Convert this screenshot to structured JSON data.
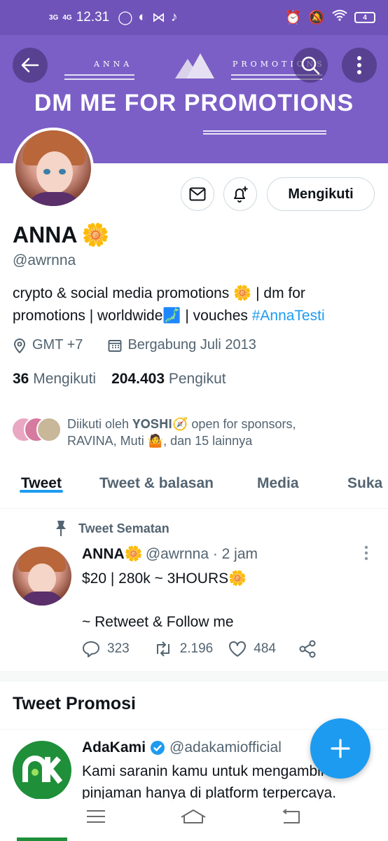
{
  "status_bar": {
    "network_1": "3G",
    "network_2": "4G",
    "time": "12.31",
    "battery": "4"
  },
  "banner": {
    "left_label": "ANNA",
    "right_label": "PROMOTIONS",
    "headline": "DM ME FOR PROMOTIONS",
    "color": "#7b5fc7"
  },
  "profile": {
    "follow_button": "Mengikuti",
    "name": "ANNA",
    "name_emoji": "🌼",
    "handle": "@awrnna",
    "bio_part1": "crypto & social media promotions 🌼  | dm for promotions | worldwide🗾 | vouches ",
    "bio_hashtag": "#AnnaTesti",
    "location": "GMT +7",
    "joined": "Bergabung Juli 2013",
    "following_count": "36",
    "following_label": "Mengikuti",
    "followers_count": "204.403",
    "followers_label": "Pengikut",
    "followed_by": "Diikuti oleh 𝐘𝐎𝐒𝐇𝐈🧭 open for sponsors, RAVINA, Muti 🤷, dan 15 lainnya"
  },
  "tabs": [
    {
      "label": "Tweet"
    },
    {
      "label": "Tweet & balasan"
    },
    {
      "label": "Media"
    },
    {
      "label": "Suka"
    }
  ],
  "pinned_tweet": {
    "pin_label": "Tweet Sematan",
    "name": "ANNA🌼",
    "handle_time": "@awrnna · 2 jam",
    "line1": "$20 | 280k ~ 3HOURS🌼",
    "line2": "~ Retweet & Follow me",
    "replies": "323",
    "retweets": "2.196",
    "likes": "484"
  },
  "promoted": {
    "section_title": "Tweet Promosi",
    "name": "AdaKami",
    "handle": "@adakamiofficial",
    "line1": "Kami saranin kamu untuk mengambil",
    "line2": "pinjaman hanya di platform terpercaya."
  },
  "colors": {
    "accent": "#1d9bf0",
    "brand_purple": "#6f53b9",
    "promo_green": "#1f8f3a"
  }
}
